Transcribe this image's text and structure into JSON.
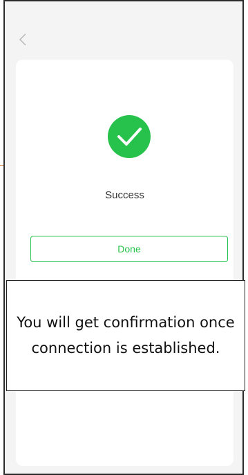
{
  "header": {
    "back_icon": "chevron-left-icon"
  },
  "result": {
    "icon": "check-circle-icon",
    "status": "Success",
    "done_label": "Done"
  },
  "note": {
    "text": "You will get confirmation once connection is established."
  },
  "colors": {
    "accent": "#27c24c",
    "background": "#f4f4f4",
    "card": "#ffffff"
  }
}
